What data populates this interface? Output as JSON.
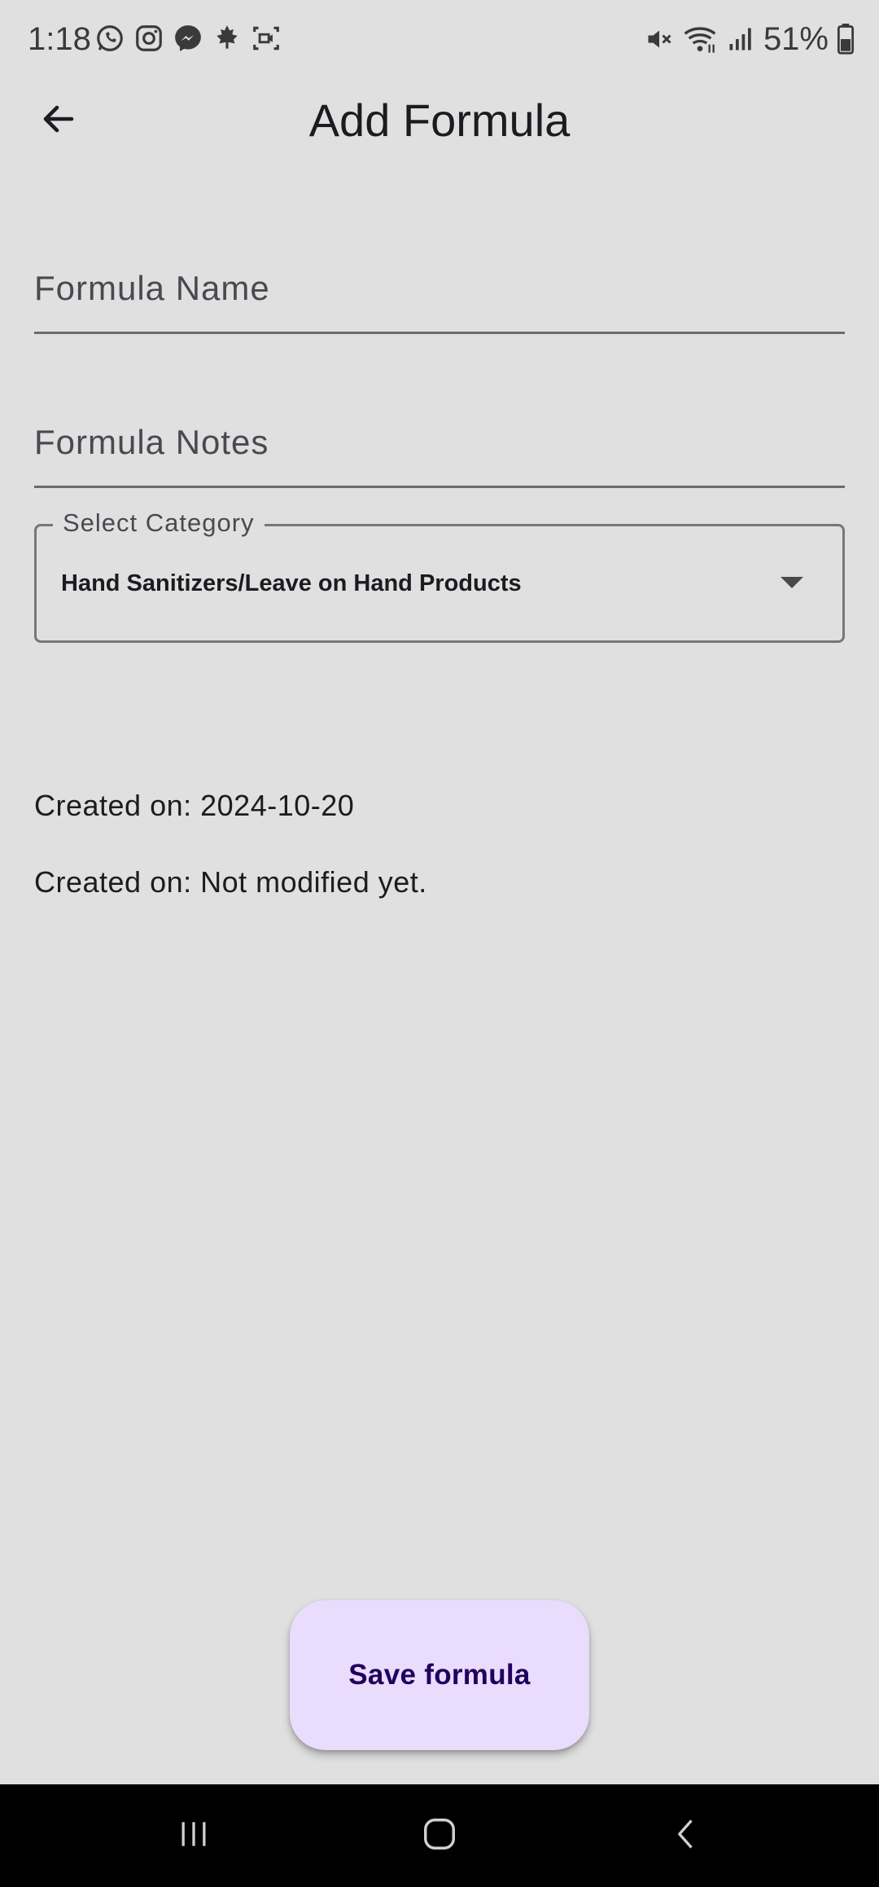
{
  "status_bar": {
    "time": "1:18",
    "notification_icons": [
      "whatsapp-icon",
      "instagram-icon",
      "messenger-icon",
      "maple-leaf-icon",
      "screen-record-icon"
    ],
    "system_icons": [
      "mute-icon",
      "wifi-icon",
      "signal-icon",
      "battery-icon"
    ],
    "battery_percent": "51%"
  },
  "app_bar": {
    "title": "Add Formula",
    "back_icon": "arrow-back-icon"
  },
  "form": {
    "formula_name": {
      "placeholder": "Formula Name",
      "value": ""
    },
    "formula_notes": {
      "placeholder": "Formula Notes",
      "value": ""
    },
    "category": {
      "label": "Select Category",
      "selected": "Hand Sanitizers/Leave on Hand Products"
    }
  },
  "info": {
    "created": "Created on: 2024-10-20",
    "modified": "Created on: Not modified yet."
  },
  "actions": {
    "save_label": "Save formula"
  },
  "nav_bar": {
    "buttons": [
      "recents-icon",
      "home-icon",
      "back-icon"
    ]
  },
  "colors": {
    "background": "#e0e0e0",
    "button_bg": "#eadcfc",
    "button_text": "#21005d",
    "nav_bar": "#000000"
  }
}
